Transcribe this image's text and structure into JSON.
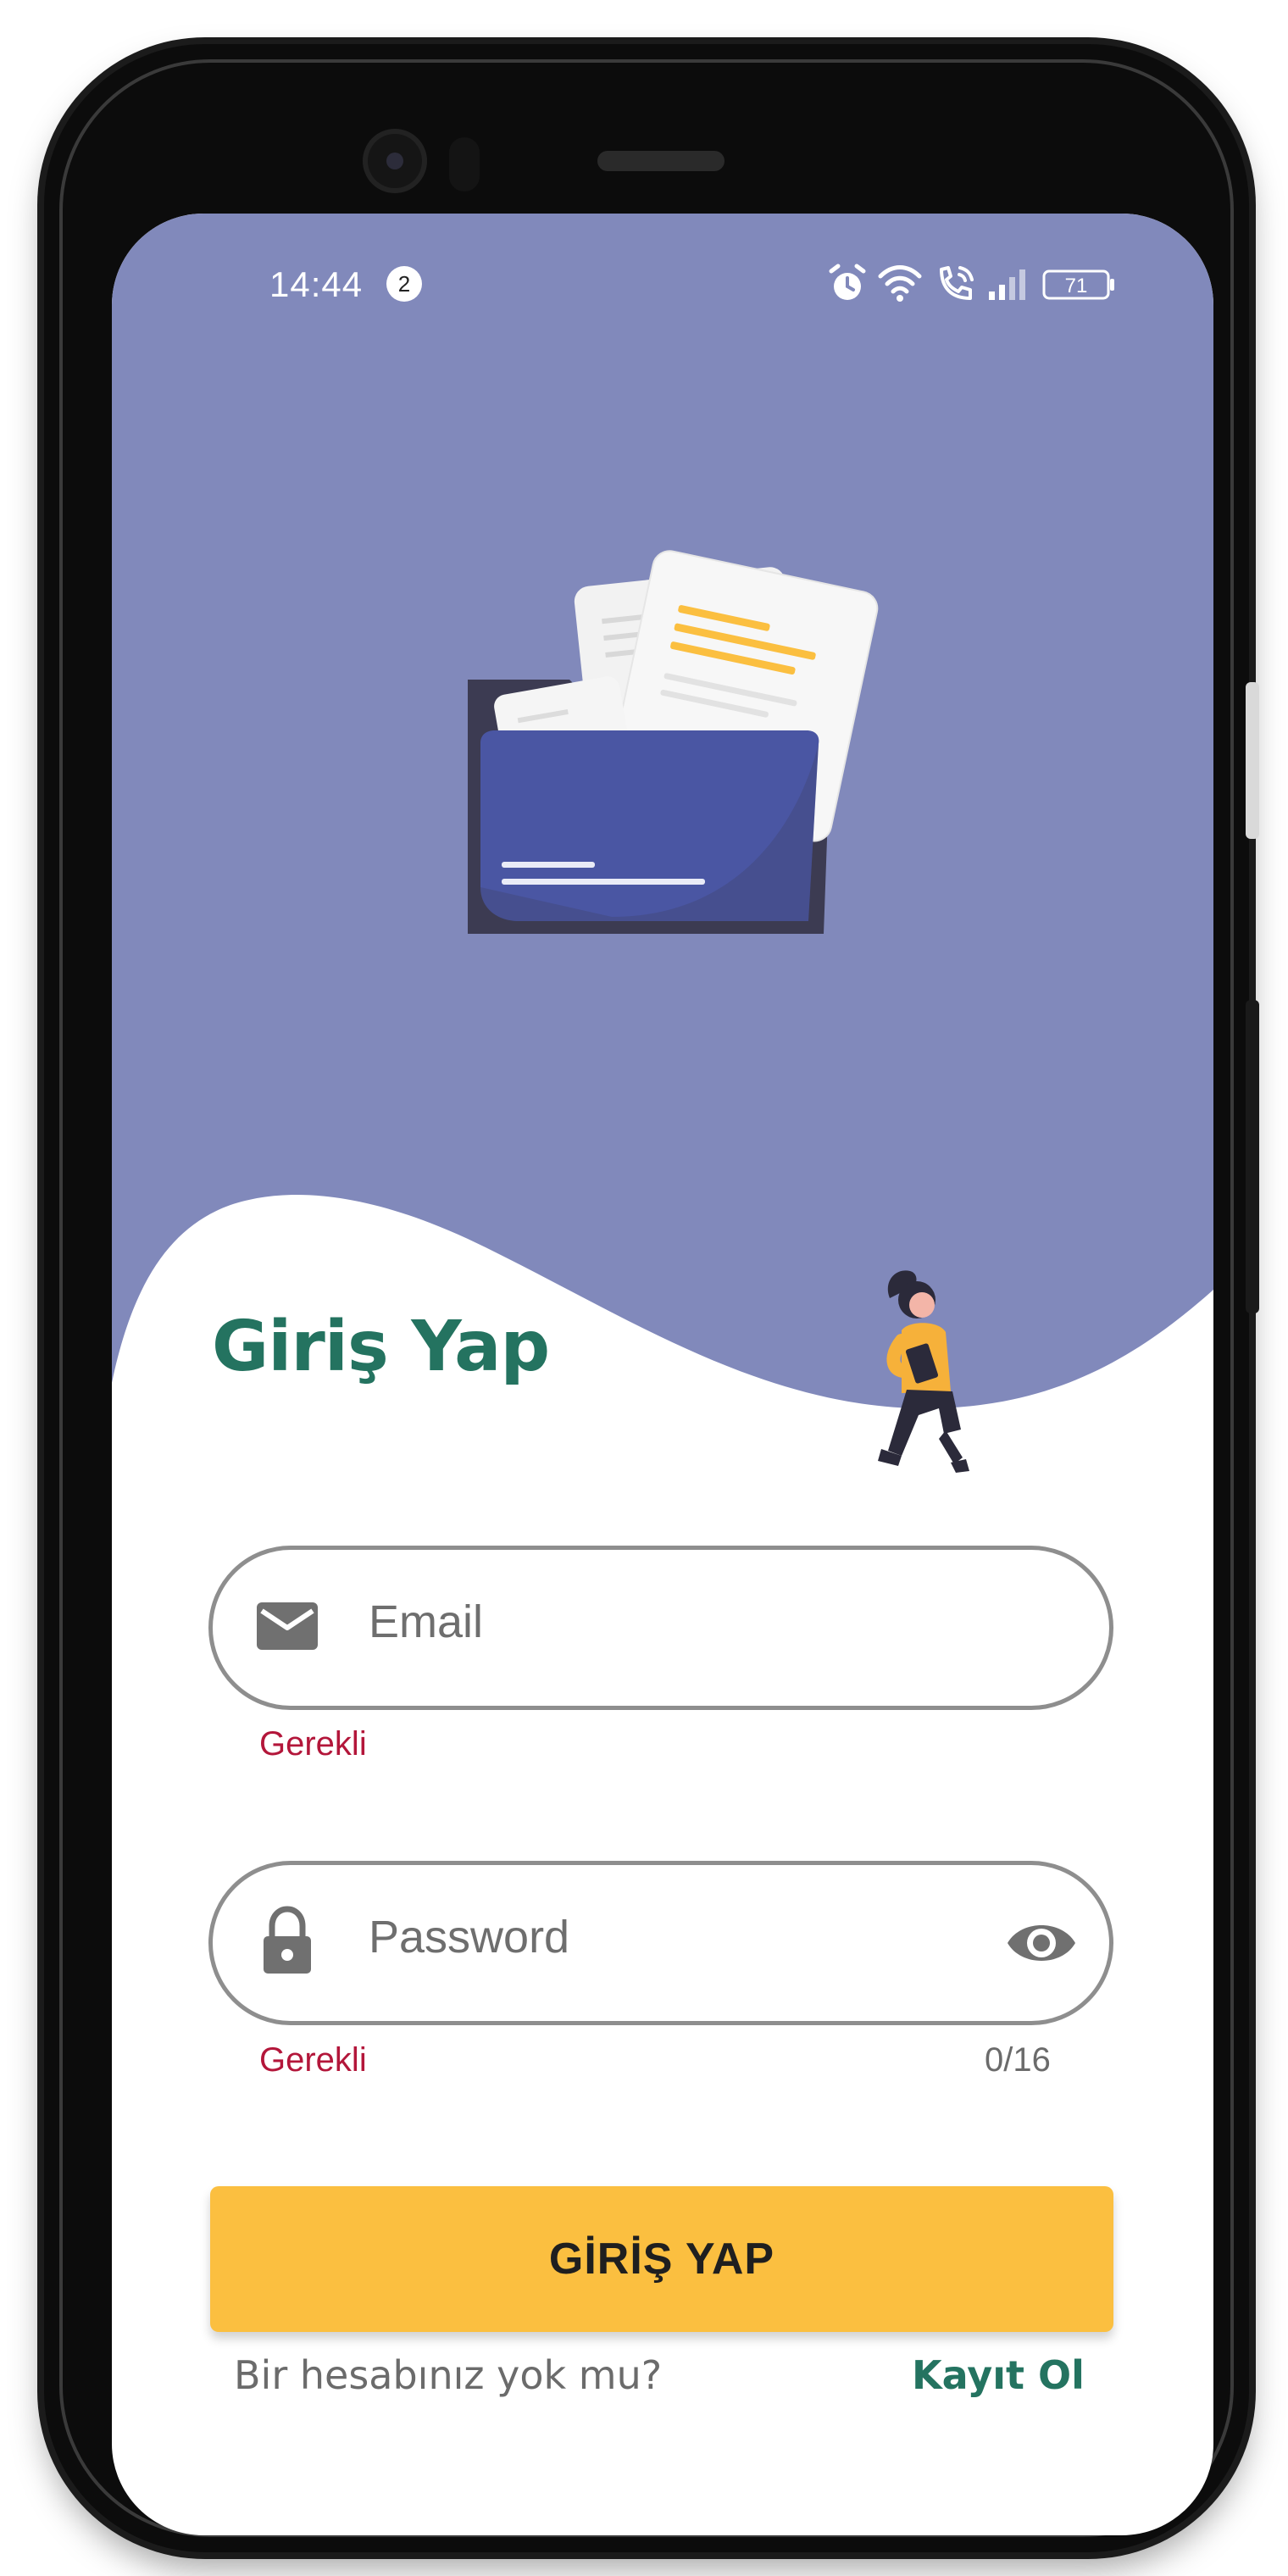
{
  "status_bar": {
    "time": "14:44",
    "notification_count": "2",
    "battery": "71"
  },
  "login": {
    "title": "Giriş Yap",
    "email_placeholder": "Email",
    "email_error": "Gerekli",
    "password_placeholder": "Password",
    "password_error": "Gerekli",
    "password_counter": "0/16",
    "submit_label": "GİRİŞ YAP",
    "no_account_text": "Bir hesabınız yok mu?",
    "register_link": "Kayıt Ol"
  },
  "icons": {
    "email_field": "mail-icon",
    "password_field": "lock-icon",
    "password_visibility": "eye-icon",
    "status": [
      "alarm-icon",
      "wifi-icon",
      "wifi-calling-icon",
      "signal-icon",
      "battery-icon"
    ]
  },
  "colors": {
    "hero_background": "#8189bb",
    "title_green": "#247360",
    "error_red": "#b3163a",
    "button_yellow": "#fbbf40",
    "folder_blue": "#4a56a3",
    "folder_dark": "#3c3b52"
  }
}
